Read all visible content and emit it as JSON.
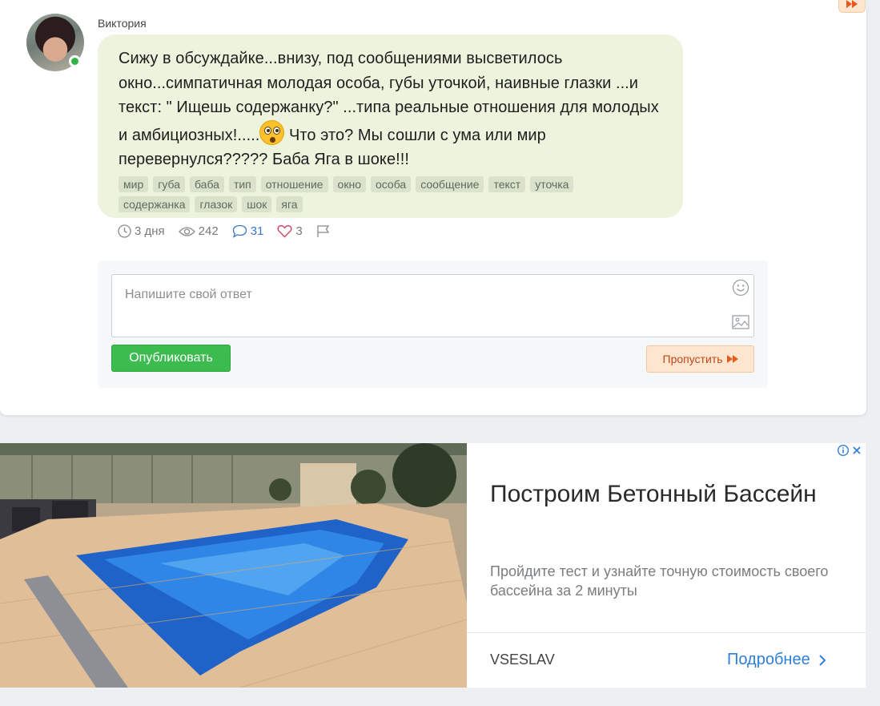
{
  "post": {
    "author": "Виктория",
    "text_before_emoji": "Сижу в обсуждайке...внизу, под сообщениями высветилось окно...симпатичная молодая особа, губы уточкой, наивные глазки ...и текст: \" Ищешь содержанку?\" ...типа реальные отношения для молодых и амбициозных!.....",
    "emoji": "astonished-face-icon",
    "text_after_emoji": " Что это? Мы сошли с ума или мир перевернулся????? Баба Яга в шоке!!!",
    "tags": [
      "мир",
      "губа",
      "баба",
      "тип",
      "отношение",
      "окно",
      "особа",
      "сообщение",
      "текст",
      "уточка",
      "содержанка",
      "глазок",
      "шок",
      "яга"
    ]
  },
  "stats": {
    "time": "3 дня",
    "views": "242",
    "comments": "31",
    "likes": "3"
  },
  "reply": {
    "placeholder": "Напишите свой ответ",
    "publish_label": "Опубликовать",
    "skip_label": "Пропустить"
  },
  "ad": {
    "title": "Построим Бетонный Бассейн",
    "description": "Пройдите тест и узнайте точную стоимость своего бассейна за 2 минуты",
    "brand": "VSESLAV",
    "cta": "Подробнее"
  },
  "colors": {
    "bubble": "#edf3dc",
    "publish": "#3cbb4f",
    "skip_bg": "#fde6cf",
    "skip_text": "#c2461b",
    "link": "#2f7fd8"
  }
}
